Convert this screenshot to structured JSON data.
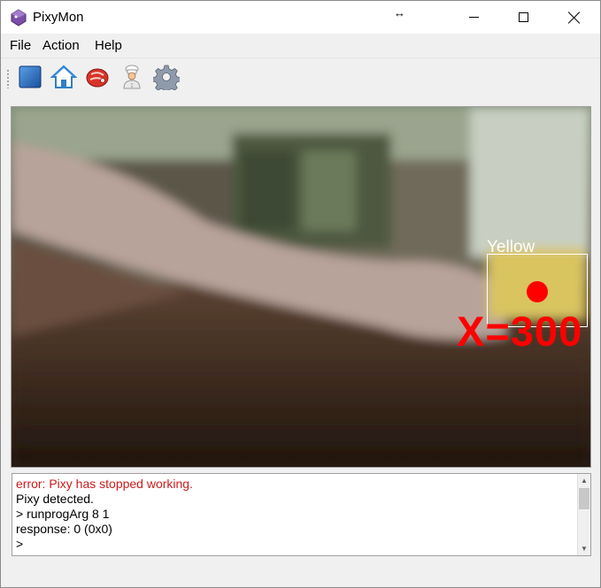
{
  "window": {
    "title": "PixyMon",
    "controls": {
      "minimize": "minimize",
      "maximize": "maximize",
      "close": "close"
    }
  },
  "menu": {
    "items": [
      {
        "label": "File"
      },
      {
        "label": "Action"
      },
      {
        "label": "Help"
      }
    ]
  },
  "toolbar": {
    "icons": [
      "run-stop-icon",
      "home-icon",
      "raw-video-icon",
      "cooked-video-icon",
      "settings-icon"
    ]
  },
  "video": {
    "block_label": "Yellow",
    "overlay_text": "X=300",
    "overlay_color": "#ff0000"
  },
  "console": {
    "lines": [
      {
        "text": "error: Pixy has stopped working.",
        "kind": "error"
      },
      {
        "text": "Pixy detected.",
        "kind": "normal"
      },
      {
        "text": "> runprogArg 8 1",
        "kind": "normal"
      },
      {
        "text": "response: 0 (0x0)",
        "kind": "normal"
      },
      {
        "text": ">",
        "kind": "normal"
      }
    ]
  }
}
